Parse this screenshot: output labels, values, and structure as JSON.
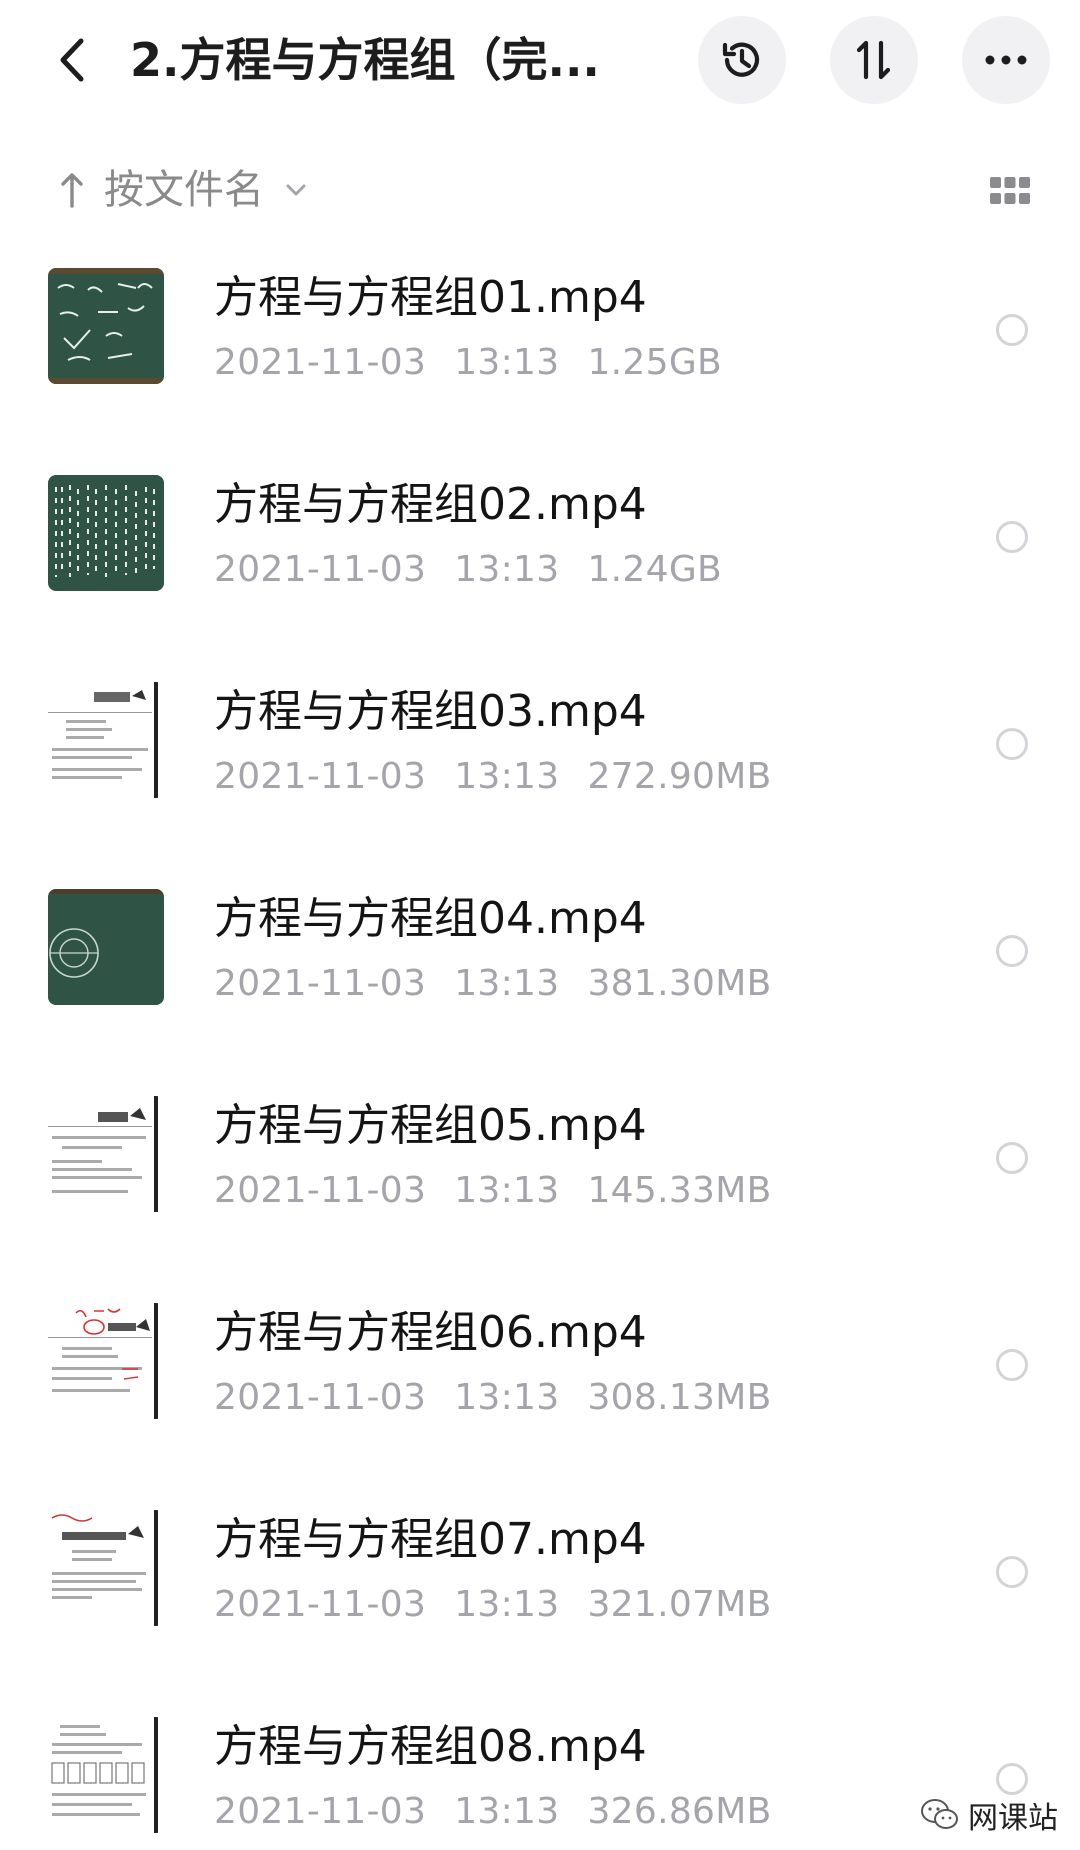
{
  "header": {
    "title": "2.方程与方程组（完...",
    "back_icon": "chevron-left-icon",
    "history_icon": "history-icon",
    "sort_icon": "sort-arrows-icon",
    "more_icon": "more-icon"
  },
  "sortbar": {
    "label": "按文件名",
    "arrow_icon": "arrow-up-icon",
    "dropdown_icon": "chevron-down-icon",
    "view_icon": "grid-view-icon"
  },
  "files": [
    {
      "name": "方程与方程组01.mp4",
      "date": "2021-11-03",
      "time": "13:13",
      "size": "1.25GB",
      "thumb": "chalkboard"
    },
    {
      "name": "方程与方程组02.mp4",
      "date": "2021-11-03",
      "time": "13:13",
      "size": "1.24GB",
      "thumb": "chalkboard-text"
    },
    {
      "name": "方程与方程组03.mp4",
      "date": "2021-11-03",
      "time": "13:13",
      "size": "272.90MB",
      "thumb": "document"
    },
    {
      "name": "方程与方程组04.mp4",
      "date": "2021-11-03",
      "time": "13:13",
      "size": "381.30MB",
      "thumb": "chalkboard-circle"
    },
    {
      "name": "方程与方程组05.mp4",
      "date": "2021-11-03",
      "time": "13:13",
      "size": "145.33MB",
      "thumb": "document"
    },
    {
      "name": "方程与方程组06.mp4",
      "date": "2021-11-03",
      "time": "13:13",
      "size": "308.13MB",
      "thumb": "document-red"
    },
    {
      "name": "方程与方程组07.mp4",
      "date": "2021-11-03",
      "time": "13:13",
      "size": "321.07MB",
      "thumb": "document"
    },
    {
      "name": "方程与方程组08.mp4",
      "date": "2021-11-03",
      "time": "13:13",
      "size": "326.86MB",
      "thumb": "document-table"
    }
  ],
  "watermark": {
    "text": "网课站",
    "icon": "wechat-icon"
  },
  "colors": {
    "chalkboard": "#2f5446",
    "meta_text": "#a4a4ab",
    "title_text": "#1d1d1d",
    "button_bg": "#f1f1f3"
  }
}
